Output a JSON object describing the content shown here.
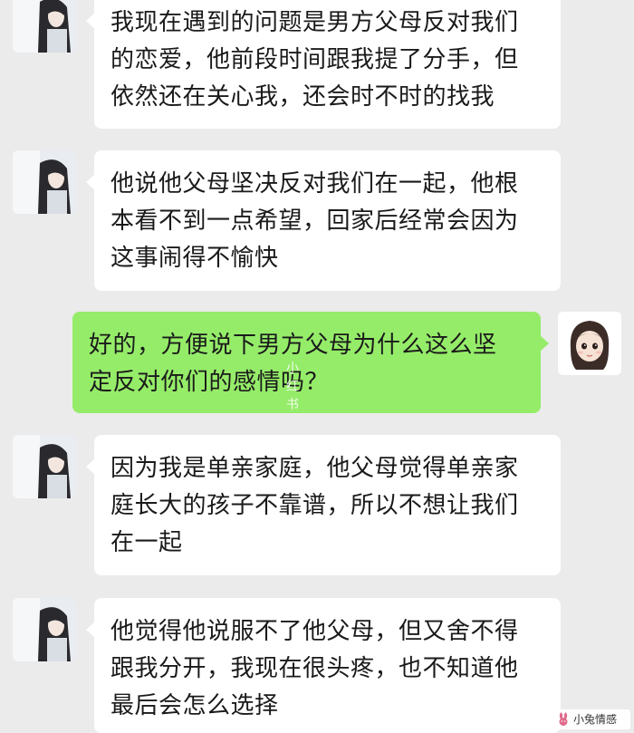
{
  "messages": [
    {
      "side": "left",
      "lines": [
        "我现在遇到的问题是男方父母反对我们",
        "的恋爱，他前段时间跟我提了分手，但",
        "依然还在关心我，还会时不时的找我"
      ]
    },
    {
      "side": "left",
      "lines": [
        "他说他父母坚决反对我们在一起，他根",
        "本看不到一点希望，回家后经常会因为",
        "这事闹得不愉快"
      ]
    },
    {
      "side": "right",
      "lines": [
        "好的，方便说下男方父母为什么这么坚",
        "定反对你们的感情吗？"
      ]
    },
    {
      "side": "left",
      "lines": [
        "因为我是单亲家庭，他父母觉得单亲家",
        "庭长大的孩子不靠谱，所以不想让我们",
        "在一起"
      ]
    },
    {
      "side": "left",
      "lines": [
        "他觉得他说服不了他父母，但又舍不得",
        "跟我分开，我现在很头疼，也不知道他",
        "最后会怎么选择"
      ]
    }
  ],
  "watermark": "小红书",
  "corner_brand": "小兔情感",
  "colors": {
    "background": "#ebebeb",
    "incoming_bubble": "#ffffff",
    "outgoing_bubble": "#95ec69"
  },
  "icons": {
    "incoming_avatar": "girl-photo-avatar",
    "outgoing_avatar": "cartoon-girl-avatar",
    "corner_logo": "rabbit-icon"
  }
}
